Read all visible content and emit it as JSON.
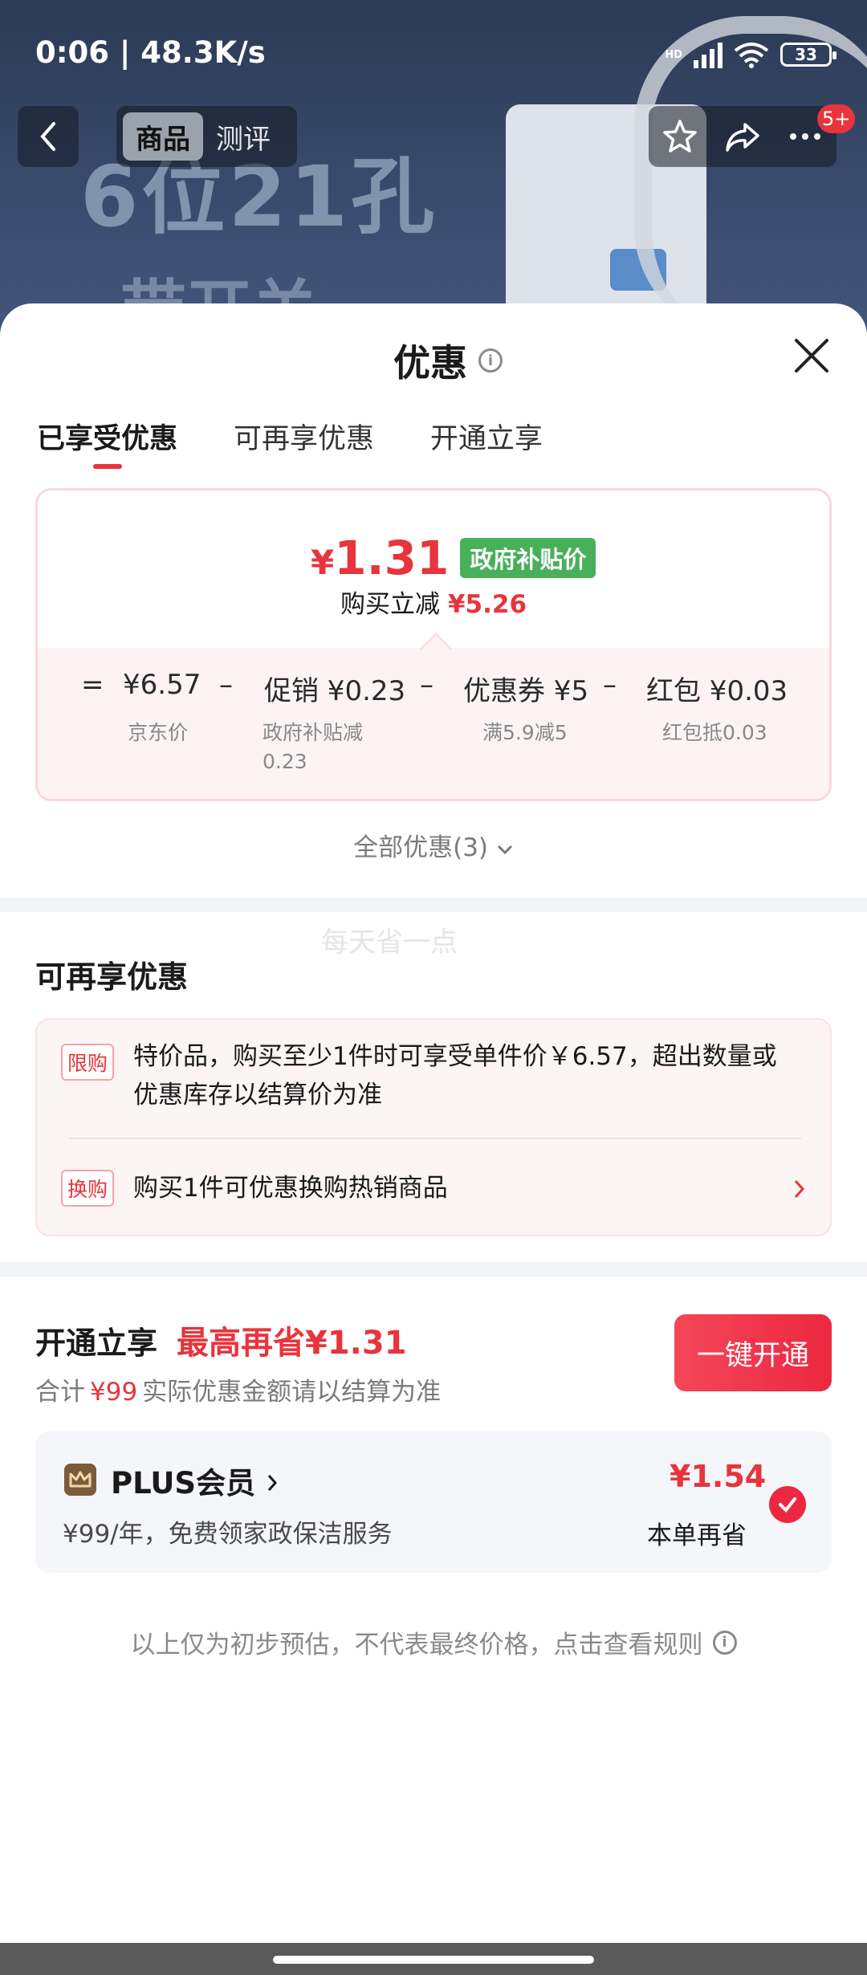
{
  "status_bar": {
    "time": "0:06 | 48.3K/s",
    "network": "HD",
    "battery": "33"
  },
  "background": {
    "headline_1": "6位21孔",
    "headline_2": "带开关"
  },
  "top_nav": {
    "tabs": [
      {
        "label": "商品",
        "active": true
      },
      {
        "label": "测评",
        "active": false
      }
    ],
    "badge": "5+"
  },
  "sheet": {
    "title": "优惠",
    "tabs": [
      {
        "label": "已享受优惠",
        "active": true
      },
      {
        "label": "可再享优惠",
        "active": false
      },
      {
        "label": "开通立享",
        "active": false
      }
    ],
    "summary": {
      "currency": "¥",
      "price": "1.31",
      "price_badge": "政府补贴价",
      "reduce_label": "购买立减",
      "reduce_value": "¥5.26",
      "formula": [
        {
          "op": "=",
          "value": "¥6.57",
          "sub": "京东价"
        },
        {
          "op": "–",
          "value": "促销 ¥0.23",
          "sub": "政府补贴减 0.23"
        },
        {
          "op": "–",
          "value": "优惠券 ¥5",
          "sub": "满5.9减5"
        },
        {
          "op": "–",
          "value": "红包 ¥0.03",
          "sub": "红包抵0.03"
        }
      ]
    },
    "all_offers": "全部优惠(3)",
    "watermark": "每天省一点",
    "more_offers": {
      "title": "可再享优惠",
      "items": [
        {
          "tag": "限购",
          "text_line1": "特价品，购买至少1件时可享受单件价￥6.57，超出数量或",
          "text_line2": "优惠库存以结算价为准"
        },
        {
          "tag": "换购",
          "text_line1": "购买1件可优惠换购热销商品"
        }
      ]
    },
    "open_now": {
      "title": "开通立享",
      "highlight": "最高再省¥1.31",
      "sub_prefix": "合计",
      "sub_amount": "¥99",
      "sub_suffix": "实际优惠金额请以结算为准",
      "button": "一键开通",
      "plus": {
        "name": "PLUS会员",
        "desc": "¥99/年，免费领家政保洁服务",
        "price": "¥1.54",
        "save_label": "本单再省",
        "checked": true
      }
    },
    "footnote": "以上仅为初步预估，不代表最终价格，点击查看规则"
  },
  "colors": {
    "accent": "#e8343c",
    "green_badge": "#48b05a",
    "card_bg": "#fdf3f4"
  }
}
